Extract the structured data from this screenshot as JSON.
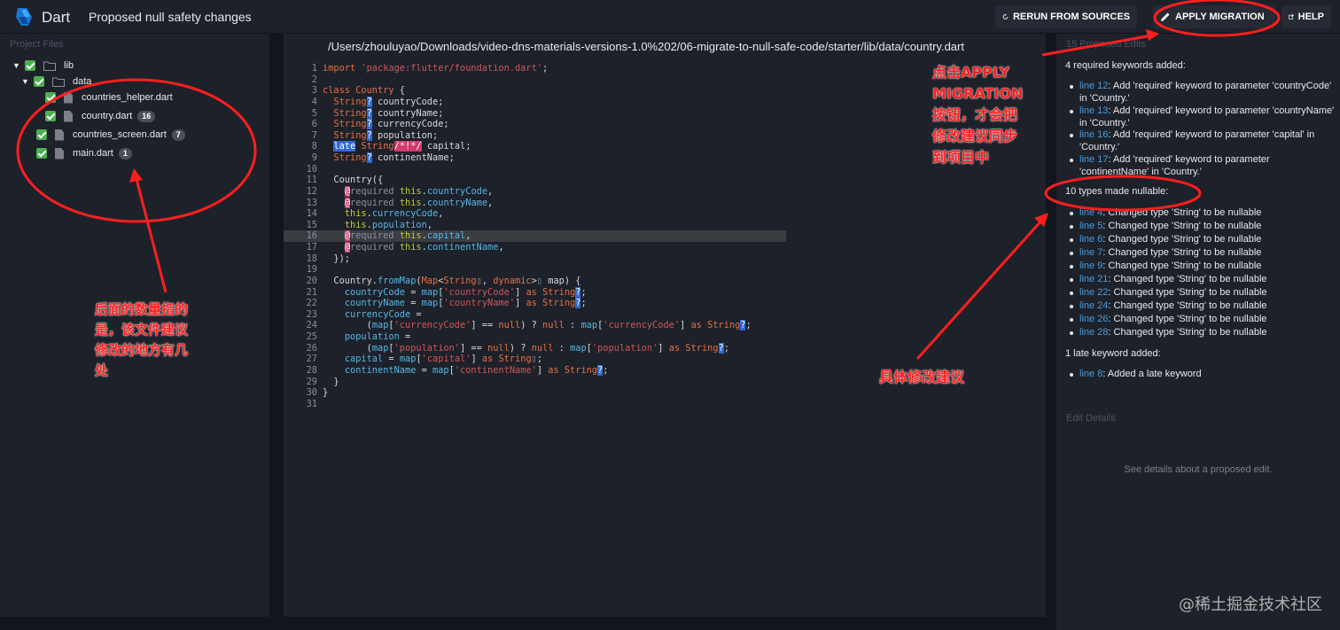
{
  "header": {
    "app_name": "Dart",
    "page_title": "Proposed null safety changes",
    "rerun_label": "RERUN FROM SOURCES",
    "apply_label": "APPLY MIGRATION",
    "help_label": "HELP"
  },
  "left_panel": {
    "heading": "Project Files",
    "tree": [
      {
        "name": "lib",
        "type": "folder",
        "expanded": true,
        "checked": true
      },
      {
        "name": "data",
        "type": "folder",
        "expanded": true,
        "checked": true
      },
      {
        "name": "countries_helper.dart",
        "type": "file",
        "checked": true,
        "badge": ""
      },
      {
        "name": "country.dart",
        "type": "file",
        "checked": true,
        "badge": "16"
      },
      {
        "name": "countries_screen.dart",
        "type": "file",
        "checked": true,
        "badge": "7"
      },
      {
        "name": "main.dart",
        "type": "file",
        "checked": true,
        "badge": "1"
      }
    ]
  },
  "editor": {
    "file_path": "/Users/zhouluyao/Downloads/video-dns-materials-versions-1.0%202/06-migrate-to-null-safe-code/starter/lib/data/country.dart",
    "highlighted_line": 16
  },
  "right_panel": {
    "proposed_edits_heading": "15 Proposed Edits",
    "groups": [
      {
        "title": "4 required keywords added:",
        "items": [
          {
            "line": "line 12",
            "text": ": Add 'required' keyword to parameter 'countryCode' in 'Country.'"
          },
          {
            "line": "line 13",
            "text": ": Add 'required' keyword to parameter 'countryName' in 'Country.'"
          },
          {
            "line": "line 16",
            "text": ": Add 'required' keyword to parameter 'capital' in 'Country.'"
          },
          {
            "line": "line 17",
            "text": ": Add 'required' keyword to parameter 'continentName' in 'Country.'"
          }
        ]
      },
      {
        "title": "10 types made nullable:",
        "items": [
          {
            "line": "line 4",
            "text": ": Changed type 'String' to be nullable"
          },
          {
            "line": "line 5",
            "text": ": Changed type 'String' to be nullable"
          },
          {
            "line": "line 6",
            "text": ": Changed type 'String' to be nullable"
          },
          {
            "line": "line 7",
            "text": ": Changed type 'String' to be nullable"
          },
          {
            "line": "line 9",
            "text": ": Changed type 'String' to be nullable"
          },
          {
            "line": "line 21",
            "text": ": Changed type 'String' to be nullable"
          },
          {
            "line": "line 22",
            "text": ": Changed type 'String' to be nullable"
          },
          {
            "line": "line 24",
            "text": ": Changed type 'String' to be nullable"
          },
          {
            "line": "line 26",
            "text": ": Changed type 'String' to be nullable"
          },
          {
            "line": "line 28",
            "text": ": Changed type 'String' to be nullable"
          }
        ]
      },
      {
        "title": "1 late keyword added:",
        "items": [
          {
            "line": "line 8",
            "text": ": Added a late keyword"
          }
        ]
      }
    ],
    "edit_details_heading": "Edit Details",
    "edit_details_message": "See details about a proposed edit."
  },
  "annotations": {
    "apply_note": "点击APPLY MIGRATION 按钮，才会把修改建议同步到项目中",
    "count_note": "后面的数量指的是，该文件建议修改的地方有几处",
    "suggestions_note": "具体修改建议",
    "color": "#ff1e1e"
  },
  "watermark": "@稀土掘金技术社区"
}
